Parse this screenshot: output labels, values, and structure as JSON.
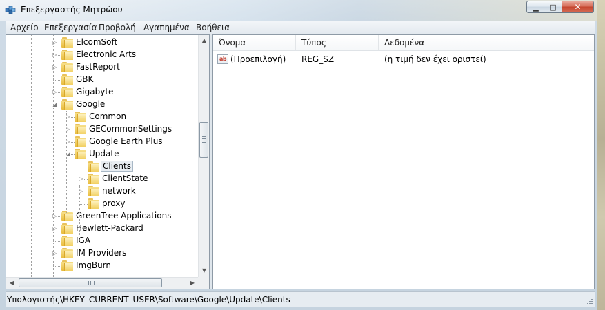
{
  "window": {
    "title": "Επεξεργαστής Μητρώου",
    "minimize_glyph": "▁",
    "maximize_glyph": "□",
    "close_glyph": "✕",
    "accent": "#c5462f"
  },
  "menu": {
    "items": [
      "Αρχείο",
      "Επεξεργασία",
      "Προβολή",
      "Αγαπημένα",
      "Βοήθεια"
    ]
  },
  "tree": {
    "items": [
      {
        "label": "ElcomSoft",
        "level": 0,
        "expander": "▷"
      },
      {
        "label": "Electronic Arts",
        "level": 0,
        "expander": "▷"
      },
      {
        "label": "FastReport",
        "level": 0,
        "expander": "▷"
      },
      {
        "label": "GBK",
        "level": 0,
        "expander": ""
      },
      {
        "label": "Gigabyte",
        "level": 0,
        "expander": "▷"
      },
      {
        "label": "Google",
        "level": 0,
        "expander": "◢"
      },
      {
        "label": "Common",
        "level": 1,
        "expander": "▷"
      },
      {
        "label": "GECommonSettings",
        "level": 1,
        "expander": "▷"
      },
      {
        "label": "Google Earth Plus",
        "level": 1,
        "expander": "▷"
      },
      {
        "label": "Update",
        "level": 1,
        "expander": "◢"
      },
      {
        "label": "Clients",
        "level": 2,
        "expander": "",
        "selected": true
      },
      {
        "label": "ClientState",
        "level": 2,
        "expander": "▷"
      },
      {
        "label": "network",
        "level": 2,
        "expander": "▷"
      },
      {
        "label": "proxy",
        "level": 2,
        "expander": ""
      },
      {
        "label": "GreenTree Applications",
        "level": 0,
        "expander": "▷"
      },
      {
        "label": "Hewlett-Packard",
        "level": 0,
        "expander": "▷"
      },
      {
        "label": "IGA",
        "level": 0,
        "expander": ""
      },
      {
        "label": "IM Providers",
        "level": 0,
        "expander": "▷"
      },
      {
        "label": "ImgBurn",
        "level": 0,
        "expander": ""
      }
    ]
  },
  "list": {
    "columns": [
      "Όνομα",
      "Τύπος",
      "Δεδομένα"
    ],
    "rows": [
      {
        "name": "(Προεπιλογή)",
        "type": "REG_SZ",
        "data": "(η τιμή δεν έχει οριστεί)",
        "icon": "string-value-icon",
        "icon_text": "ab"
      }
    ]
  },
  "status": {
    "path": "Υπολογιστής\\HKEY_CURRENT_USER\\Software\\Google\\Update\\Clients"
  },
  "scrollbars": {
    "up": "▲",
    "down": "▼",
    "left": "◀",
    "right": "▶"
  }
}
